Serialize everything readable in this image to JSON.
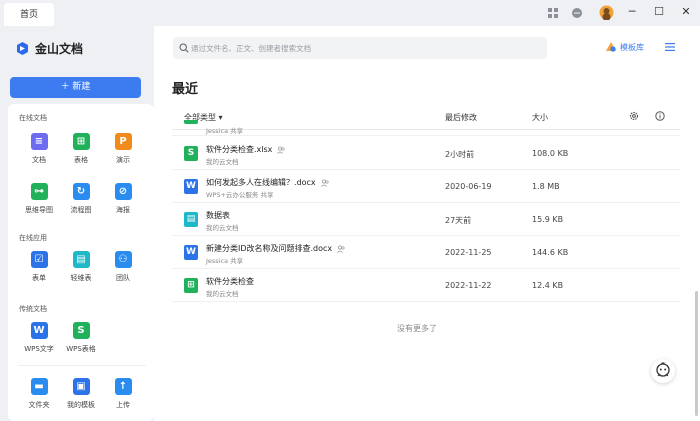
{
  "tab": {
    "home": "首页"
  },
  "app": {
    "name": "金山文档"
  },
  "sidebar": {
    "new_label": "＋ 新建",
    "sections": [
      {
        "title": "在线文档",
        "items": [
          "文档",
          "表格",
          "演示",
          "思维导图",
          "流程图",
          "海报"
        ]
      },
      {
        "title": "在线应用",
        "items": [
          "表单",
          "轻维表",
          "团队"
        ]
      },
      {
        "title": "传统文档",
        "items": [
          "WPS文字",
          "WPS表格"
        ]
      }
    ],
    "bottom_items": [
      "文件夹",
      "我的模板",
      "上传"
    ]
  },
  "search": {
    "placeholder": "通过文件名、正文、创建者搜索文档"
  },
  "header": {
    "template_label": "模板库"
  },
  "main": {
    "title": "最近",
    "columns": {
      "type_filter": "全部类型 ▾",
      "modified": "最后修改",
      "size": "大小"
    },
    "partial_row_sub": "Jessica 共享",
    "files": [
      {
        "name": "软件分类检查.xlsx",
        "sub": "我的云文档",
        "date": "2小时前",
        "size": "108.0 KB",
        "icon": "S",
        "color": "#20b15a",
        "shared": true
      },
      {
        "name": "如何发起多人在线编辑？.docx",
        "sub": "WPS+云办公服务 共享",
        "date": "2020-06-19",
        "size": "1.8 MB",
        "icon": "W",
        "color": "#2b73e6",
        "shared": true
      },
      {
        "name": "数据表",
        "sub": "我的云文档",
        "date": "27天前",
        "size": "15.9 KB",
        "icon": "▤",
        "color": "#1fb8c9",
        "shared": false
      },
      {
        "name": "新建分类ID改名称及问题排查.docx",
        "sub": "Jessica 共享",
        "date": "2022-11-25",
        "size": "144.6 KB",
        "icon": "W",
        "color": "#2b73e6",
        "shared": true
      },
      {
        "name": "软件分类检查",
        "sub": "我的云文档",
        "date": "2022-11-22",
        "size": "12.4 KB",
        "icon": "⊞",
        "color": "#20b15a",
        "shared": false
      }
    ],
    "no_more": "没有更多了"
  }
}
